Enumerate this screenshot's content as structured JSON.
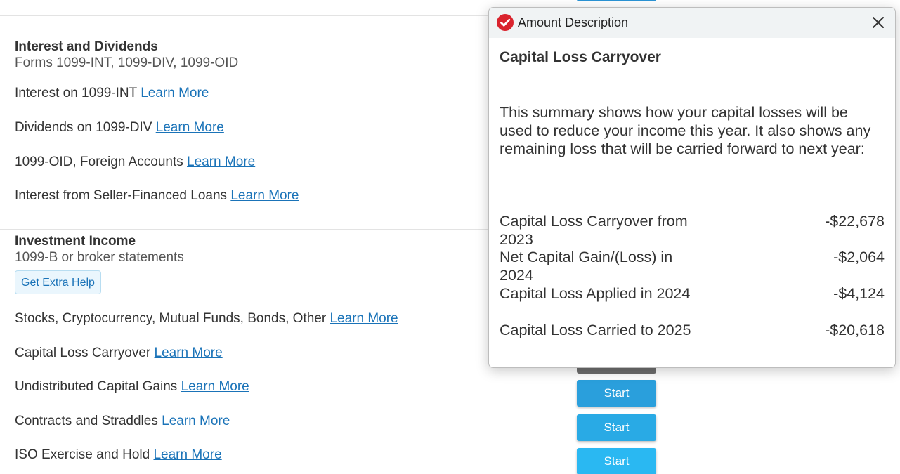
{
  "interest_section": {
    "title": "Interest and Dividends",
    "subtitle": "Forms 1099-INT, 1099-DIV, 1099-OID",
    "items": [
      {
        "label": "Interest on 1099-INT",
        "link": "Learn More"
      },
      {
        "label": "Dividends on 1099-DIV",
        "link": "Learn More"
      },
      {
        "label": "1099-OID, Foreign Accounts",
        "link": "Learn More"
      },
      {
        "label": "Interest from Seller-Financed Loans",
        "link": "Learn More"
      }
    ]
  },
  "investment_section": {
    "title": "Investment Income",
    "subtitle": "1099-B or broker statements",
    "extra_help_label": "Get Extra Help",
    "items": [
      {
        "label": "Stocks, Cryptocurrency, Mutual Funds, Bonds, Other",
        "link": "Learn More"
      },
      {
        "label": "Capital Loss Carryover",
        "link": "Learn More"
      },
      {
        "label": "Undistributed Capital Gains",
        "link": "Learn More"
      },
      {
        "label": "Contracts and Straddles",
        "link": "Learn More"
      },
      {
        "label": "ISO Exercise and Hold",
        "link": "Learn More"
      }
    ]
  },
  "start_buttons": [
    {
      "label": "Start",
      "color": "#2a9fdc"
    },
    {
      "label": "Start",
      "color": "#29aae5"
    },
    {
      "label": "Start",
      "color": "#2ab8f2"
    }
  ],
  "popup": {
    "title": "Amount Description",
    "heading": "Capital Loss Carryover",
    "body": "This summary shows how your capital losses will be used to reduce your income this year. It also shows any remaining loss that will be carried forward to next year:",
    "rows": [
      {
        "label": "Capital Loss Carryover from 2023",
        "value": "-$22,678"
      },
      {
        "label": "Net Capital Gain/(Loss) in 2024",
        "value": "-$2,064"
      },
      {
        "label": "Capital Loss Applied in 2024",
        "value": "-$4,124"
      },
      {
        "label": "Capital Loss Carried to 2025",
        "value": "-$20,618"
      }
    ],
    "icons": {
      "status": "check-circle-icon",
      "close": "close-icon"
    },
    "colors": {
      "status": "#d9232d",
      "header_bg": "#f0f3f4"
    }
  },
  "colors": {
    "link": "#1a73b8",
    "extra_help_bg": "#eaf6fd"
  }
}
